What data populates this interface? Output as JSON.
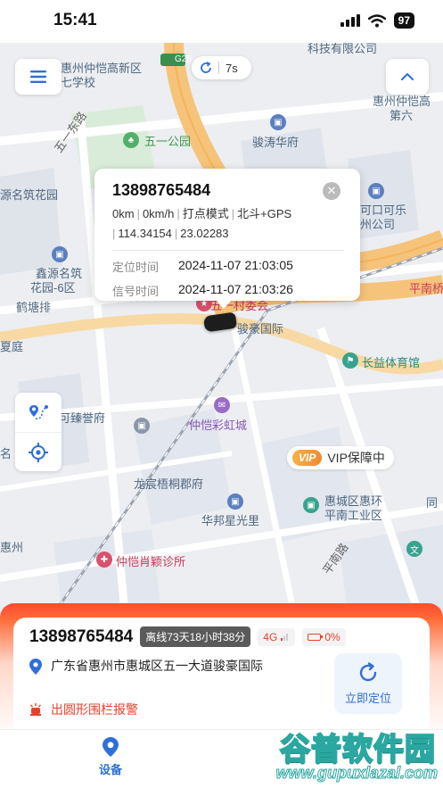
{
  "status_bar": {
    "time": "15:41",
    "battery": "97"
  },
  "map": {
    "labels": [
      {
        "text": "科技有限公司",
        "cls": ""
      },
      {
        "text": "惠州仲恺高新区",
        "cls": ""
      },
      {
        "text": "七学校",
        "cls": ""
      },
      {
        "text": "五一公园",
        "cls": "green"
      },
      {
        "text": "骏涛华府",
        "cls": ""
      },
      {
        "text": "惠州仲恺高",
        "cls": ""
      },
      {
        "text": "第六",
        "cls": ""
      },
      {
        "text": "源名筑花园",
        "cls": ""
      },
      {
        "text": "鑫源名筑",
        "cls": ""
      },
      {
        "text": "花园-6区",
        "cls": ""
      },
      {
        "text": "鹤塘排",
        "cls": ""
      },
      {
        "text": "可口可乐",
        "cls": ""
      },
      {
        "text": "州公司",
        "cls": ""
      },
      {
        "text": "平南桥",
        "cls": "pink"
      },
      {
        "text": "五一村委会",
        "cls": "pink"
      },
      {
        "text": "骏豪国际",
        "cls": ""
      },
      {
        "text": "长益体育馆",
        "cls": "teal"
      },
      {
        "text": "夏庭",
        "cls": ""
      },
      {
        "text": "可臻誉府",
        "cls": ""
      },
      {
        "text": "仲恺彩虹城",
        "cls": "purple"
      },
      {
        "text": "龙宸梧桐郡府",
        "cls": ""
      },
      {
        "text": "华邦星光里",
        "cls": ""
      },
      {
        "text": "惠城区惠环",
        "cls": ""
      },
      {
        "text": "平南工业区",
        "cls": ""
      },
      {
        "text": "仲恺肖颖诊所",
        "cls": "pink"
      },
      {
        "text": "惠州",
        "cls": ""
      },
      {
        "text": "文",
        "cls": ""
      },
      {
        "text": "同",
        "cls": ""
      },
      {
        "text": "名",
        "cls": ""
      }
    ],
    "road_labels": [
      "五一东路",
      "平南路"
    ],
    "highway_shield": "G25",
    "refresh_interval": "7s"
  },
  "popup": {
    "phone": "13898765484",
    "speed_line": [
      "0km",
      "0km/h",
      "打点模式",
      "北斗+GPS"
    ],
    "coords": [
      "114.34154",
      "23.02283"
    ],
    "fix_time_label": "定位时间",
    "fix_time": "2024-11-07 21:03:05",
    "signal_time_label": "信号时间",
    "signal_time": "2024-11-07 21:03:26"
  },
  "vip": {
    "tag": "VIP",
    "text": "VIP保障中"
  },
  "card": {
    "phone": "13898765484",
    "status": "离线73天18小时38分",
    "network": "4G",
    "battery": "0%",
    "address": "广东省惠州市惠城区五一大道骏豪国际",
    "alarm": "出圆形围栏报警",
    "locate_label": "立即定位"
  },
  "tabbar": {
    "device_label": "设备"
  },
  "watermark": {
    "title": "谷普软件园",
    "url": "www.gupuxlazal.com"
  },
  "colors": {
    "accent_blue": "#2f6fd6",
    "alert_red": "#e8402a",
    "card_top": "#ff4a2e"
  }
}
